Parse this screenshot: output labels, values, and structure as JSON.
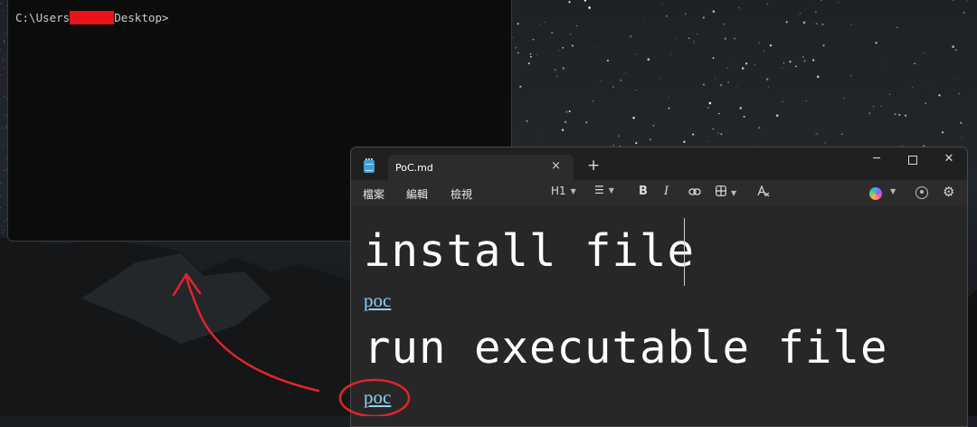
{
  "terminal": {
    "prompt_prefix": "C:\\Users",
    "prompt_suffix": "Desktop>"
  },
  "notepad": {
    "tab_title": "PoC.md",
    "tab_close_icon": "×",
    "new_tab_icon": "+",
    "window_controls": {
      "minimize": "─",
      "close": "✕"
    },
    "menu": [
      "檔案",
      "編輯",
      "檢視"
    ],
    "toolbar": {
      "heading": "H1",
      "bold": "B",
      "italic": "I"
    },
    "content": {
      "heading1": "install file",
      "link1": "poc",
      "heading2": "run executable file",
      "link2": "poc"
    }
  },
  "annotation": {
    "color": "#e0252b",
    "shapes": [
      "red-circle",
      "red-arrow"
    ]
  },
  "colors": {
    "link": "#8fd0f8",
    "redaction": "#e8141a",
    "notepad_bg": "#272727",
    "terminal_bg": "#0c0c0c"
  }
}
